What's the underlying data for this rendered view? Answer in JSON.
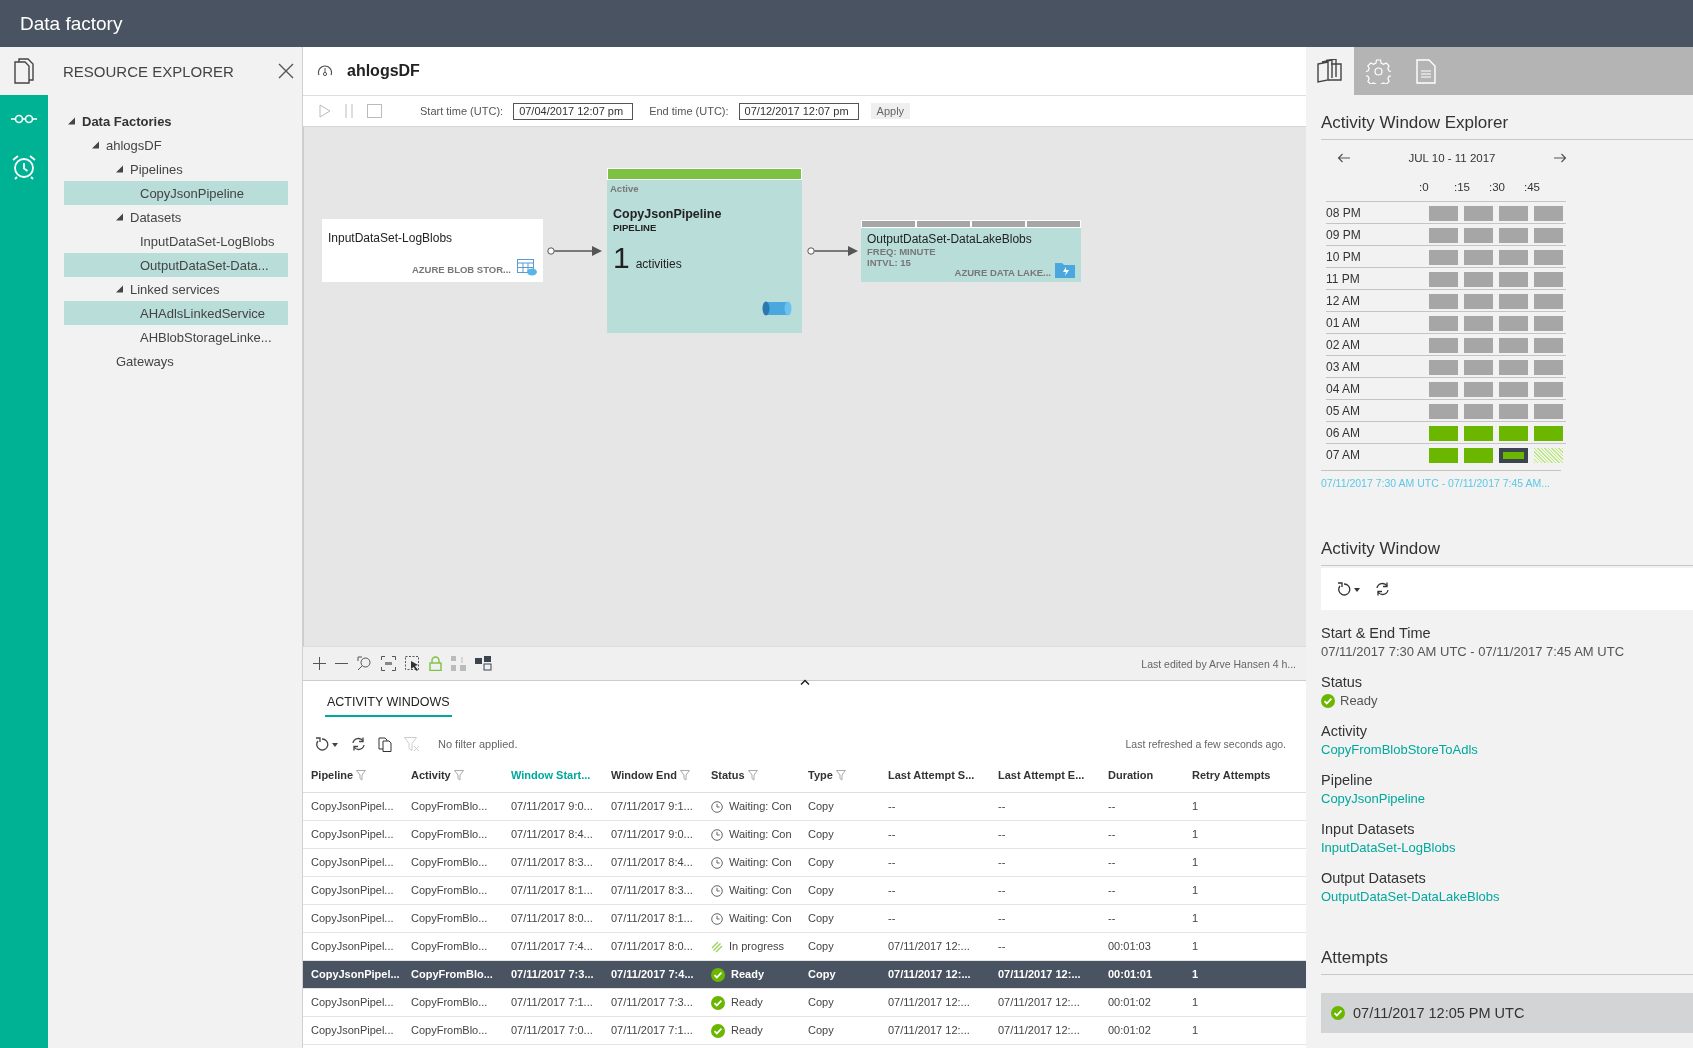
{
  "app": {
    "title": "Data factory"
  },
  "rail": {
    "items": [
      {
        "kind": "documents",
        "selected": true
      },
      {
        "kind": "glasses",
        "selected": false
      },
      {
        "kind": "alarm",
        "selected": false
      }
    ]
  },
  "explorer": {
    "title": "RESOURCE EXPLORER",
    "tree": [
      {
        "label": "Data Factories",
        "expanded": true,
        "selected": false,
        "children": [
          {
            "label": "ahlogsDF",
            "expanded": true,
            "selected": false,
            "children": [
              {
                "label": "Pipelines",
                "expanded": true,
                "selected": false,
                "children": [
                  {
                    "label": "CopyJsonPipeline",
                    "selected": true
                  }
                ]
              },
              {
                "label": "Datasets",
                "expanded": true,
                "selected": false,
                "children": [
                  {
                    "label": "InputDataSet-LogBlobs",
                    "selected": false
                  },
                  {
                    "label": "OutputDataSet-Data...",
                    "selected": true
                  }
                ]
              },
              {
                "label": "Linked services",
                "expanded": true,
                "selected": false,
                "children": [
                  {
                    "label": "AHAdlsLinkedService",
                    "selected": true
                  },
                  {
                    "label": "AHBlobStorageLinke...",
                    "selected": false
                  }
                ]
              },
              {
                "label": "Gateways",
                "selected": false
              }
            ]
          }
        ]
      }
    ]
  },
  "factory": {
    "name": "ahlogsDF",
    "start_label": "Start time (UTC):",
    "start_value": "07/04/2017 12:07 pm",
    "end_label": "End time (UTC):",
    "end_value": "07/12/2017 12:07 pm",
    "apply": "Apply"
  },
  "diagram": {
    "input": {
      "name": "InputDataSet-LogBlobs",
      "store": "AZURE BLOB STOR..."
    },
    "pipeline": {
      "status": "Active",
      "name": "CopyJsonPipeline",
      "type": "PIPELINE",
      "count": "1",
      "count_label": "activities"
    },
    "output": {
      "name": "OutputDataSet-DataLakeBlobs",
      "freq": "FREQ: MINUTE",
      "interval": "INTVL: 15",
      "store": "AZURE DATA LAKE...",
      "slices": [
        {
          "kind": "pending"
        },
        {
          "kind": "pending"
        },
        {
          "kind": "pending"
        },
        {
          "kind": "pending"
        }
      ]
    }
  },
  "canvas_footer": {
    "last_edited": "Last edited by Arve Hansen 4 h..."
  },
  "activity_windows": {
    "tab": "ACTIVITY WINDOWS",
    "filter_text": "No filter applied.",
    "refreshed": "Last refreshed a few seconds ago.",
    "columns": [
      {
        "label": "Pipeline",
        "filter": true,
        "sorted": false
      },
      {
        "label": "Activity",
        "filter": true,
        "sorted": false
      },
      {
        "label": "Window Start...",
        "filter": false,
        "sorted": true
      },
      {
        "label": "Window End",
        "filter": true,
        "sorted": false
      },
      {
        "label": "Status",
        "filter": true,
        "sorted": false
      },
      {
        "label": "Type",
        "filter": true,
        "sorted": false
      },
      {
        "label": "Last Attempt S...",
        "filter": false,
        "sorted": false
      },
      {
        "label": "Last Attempt E...",
        "filter": false,
        "sorted": false
      },
      {
        "label": "Duration",
        "filter": false,
        "sorted": false
      },
      {
        "label": "Retry Attempts",
        "filter": false,
        "sorted": false
      }
    ],
    "rows": [
      {
        "kind": "waiting",
        "selected": false,
        "cells": [
          "CopyJsonPipel...",
          "CopyFromBlo...",
          "07/11/2017 9:0...",
          "07/11/2017 9:1...",
          "Waiting: Con",
          "Copy",
          "--",
          "--",
          "--",
          "1"
        ]
      },
      {
        "kind": "waiting",
        "selected": false,
        "cells": [
          "CopyJsonPipel...",
          "CopyFromBlo...",
          "07/11/2017 8:4...",
          "07/11/2017 9:0...",
          "Waiting: Con",
          "Copy",
          "--",
          "--",
          "--",
          "1"
        ]
      },
      {
        "kind": "waiting",
        "selected": false,
        "cells": [
          "CopyJsonPipel...",
          "CopyFromBlo...",
          "07/11/2017 8:3...",
          "07/11/2017 8:4...",
          "Waiting: Con",
          "Copy",
          "--",
          "--",
          "--",
          "1"
        ]
      },
      {
        "kind": "waiting",
        "selected": false,
        "cells": [
          "CopyJsonPipel...",
          "CopyFromBlo...",
          "07/11/2017 8:1...",
          "07/11/2017 8:3...",
          "Waiting: Con",
          "Copy",
          "--",
          "--",
          "--",
          "1"
        ]
      },
      {
        "kind": "waiting",
        "selected": false,
        "cells": [
          "CopyJsonPipel...",
          "CopyFromBlo...",
          "07/11/2017 8:0...",
          "07/11/2017 8:1...",
          "Waiting: Con",
          "Copy",
          "--",
          "--",
          "--",
          "1"
        ]
      },
      {
        "kind": "in-progress",
        "selected": false,
        "cells": [
          "CopyJsonPipel...",
          "CopyFromBlo...",
          "07/11/2017 7:4...",
          "07/11/2017 8:0...",
          "In progress",
          "Copy",
          "07/11/2017 12:...",
          "--",
          "00:01:03",
          "1"
        ]
      },
      {
        "kind": "ready",
        "selected": true,
        "cells": [
          "CopyJsonPipel...",
          "CopyFromBlo...",
          "07/11/2017 7:3...",
          "07/11/2017 7:4...",
          "Ready",
          "Copy",
          "07/11/2017 12:...",
          "07/11/2017 12:...",
          "00:01:01",
          "1"
        ]
      },
      {
        "kind": "ready",
        "selected": false,
        "cells": [
          "CopyJsonPipel...",
          "CopyFromBlo...",
          "07/11/2017 7:1...",
          "07/11/2017 7:3...",
          "Ready",
          "Copy",
          "07/11/2017 12:...",
          "07/11/2017 12:...",
          "00:01:02",
          "1"
        ]
      },
      {
        "kind": "ready",
        "selected": false,
        "cells": [
          "CopyJsonPipel...",
          "CopyFromBlo...",
          "07/11/2017 7:0...",
          "07/11/2017 7:1...",
          "Ready",
          "Copy",
          "07/11/2017 12:...",
          "07/11/2017 12:...",
          "00:01:02",
          "1"
        ]
      }
    ]
  },
  "window_explorer": {
    "tabs": [
      {
        "kind": "books",
        "selected": true
      },
      {
        "kind": "gear",
        "selected": false
      },
      {
        "kind": "document",
        "selected": false
      }
    ],
    "title": "Activity Window Explorer",
    "range": "JUL 10 - 11 2017",
    "minutes": [
      ":0",
      ":15",
      ":30",
      ":45"
    ],
    "hours": [
      {
        "label": "08 PM",
        "cells": [
          {
            "kind": "pending",
            "selected": false
          },
          {
            "kind": "pending",
            "selected": false
          },
          {
            "kind": "pending",
            "selected": false
          },
          {
            "kind": "pending",
            "selected": false
          }
        ]
      },
      {
        "label": "09 PM",
        "cells": [
          {
            "kind": "pending",
            "selected": false
          },
          {
            "kind": "pending",
            "selected": false
          },
          {
            "kind": "pending",
            "selected": false
          },
          {
            "kind": "pending",
            "selected": false
          }
        ]
      },
      {
        "label": "10 PM",
        "cells": [
          {
            "kind": "pending",
            "selected": false
          },
          {
            "kind": "pending",
            "selected": false
          },
          {
            "kind": "pending",
            "selected": false
          },
          {
            "kind": "pending",
            "selected": false
          }
        ]
      },
      {
        "label": "11 PM",
        "cells": [
          {
            "kind": "pending",
            "selected": false
          },
          {
            "kind": "pending",
            "selected": false
          },
          {
            "kind": "pending",
            "selected": false
          },
          {
            "kind": "pending",
            "selected": false
          }
        ]
      },
      {
        "label": "12 AM",
        "cells": [
          {
            "kind": "pending",
            "selected": false
          },
          {
            "kind": "pending",
            "selected": false
          },
          {
            "kind": "pending",
            "selected": false
          },
          {
            "kind": "pending",
            "selected": false
          }
        ]
      },
      {
        "label": "01 AM",
        "cells": [
          {
            "kind": "pending",
            "selected": false
          },
          {
            "kind": "pending",
            "selected": false
          },
          {
            "kind": "pending",
            "selected": false
          },
          {
            "kind": "pending",
            "selected": false
          }
        ]
      },
      {
        "label": "02 AM",
        "cells": [
          {
            "kind": "pending",
            "selected": false
          },
          {
            "kind": "pending",
            "selected": false
          },
          {
            "kind": "pending",
            "selected": false
          },
          {
            "kind": "pending",
            "selected": false
          }
        ]
      },
      {
        "label": "03 AM",
        "cells": [
          {
            "kind": "pending",
            "selected": false
          },
          {
            "kind": "pending",
            "selected": false
          },
          {
            "kind": "pending",
            "selected": false
          },
          {
            "kind": "pending",
            "selected": false
          }
        ]
      },
      {
        "label": "04 AM",
        "cells": [
          {
            "kind": "pending",
            "selected": false
          },
          {
            "kind": "pending",
            "selected": false
          },
          {
            "kind": "pending",
            "selected": false
          },
          {
            "kind": "pending",
            "selected": false
          }
        ]
      },
      {
        "label": "05 AM",
        "cells": [
          {
            "kind": "pending",
            "selected": false
          },
          {
            "kind": "pending",
            "selected": false
          },
          {
            "kind": "pending",
            "selected": false
          },
          {
            "kind": "pending",
            "selected": false
          }
        ]
      },
      {
        "label": "06 AM",
        "cells": [
          {
            "kind": "ready",
            "selected": false
          },
          {
            "kind": "ready",
            "selected": false
          },
          {
            "kind": "ready",
            "selected": false
          },
          {
            "kind": "ready",
            "selected": false
          }
        ]
      },
      {
        "label": "07 AM",
        "cells": [
          {
            "kind": "ready",
            "selected": false
          },
          {
            "kind": "ready",
            "selected": false
          },
          {
            "kind": "ready",
            "selected": true
          },
          {
            "kind": "in-progress",
            "selected": false
          }
        ]
      }
    ],
    "selection": "07/11/2017 7:30 AM UTC - 07/11/2017 7:45 AM..."
  },
  "activity_window": {
    "title": "Activity Window",
    "fields": [
      {
        "kind": "text",
        "label": "Start & End Time",
        "value": "07/11/2017 7:30 AM UTC - 07/11/2017 7:45 AM UTC"
      },
      {
        "kind": "ready",
        "label": "Status",
        "value": "Ready"
      },
      {
        "kind": "link",
        "label": "Activity",
        "value": "CopyFromBlobStoreToAdls"
      },
      {
        "kind": "link",
        "label": "Pipeline",
        "value": "CopyJsonPipeline"
      },
      {
        "kind": "link",
        "label": "Input Datasets",
        "value": "InputDataSet-LogBlobs"
      },
      {
        "kind": "link",
        "label": "Output Datasets",
        "value": "OutputDataSet-DataLakeBlobs"
      }
    ]
  },
  "attempts": {
    "title": "Attempts",
    "items": [
      {
        "kind": "ready",
        "time": "07/11/2017 12:05 PM UTC"
      }
    ]
  }
}
